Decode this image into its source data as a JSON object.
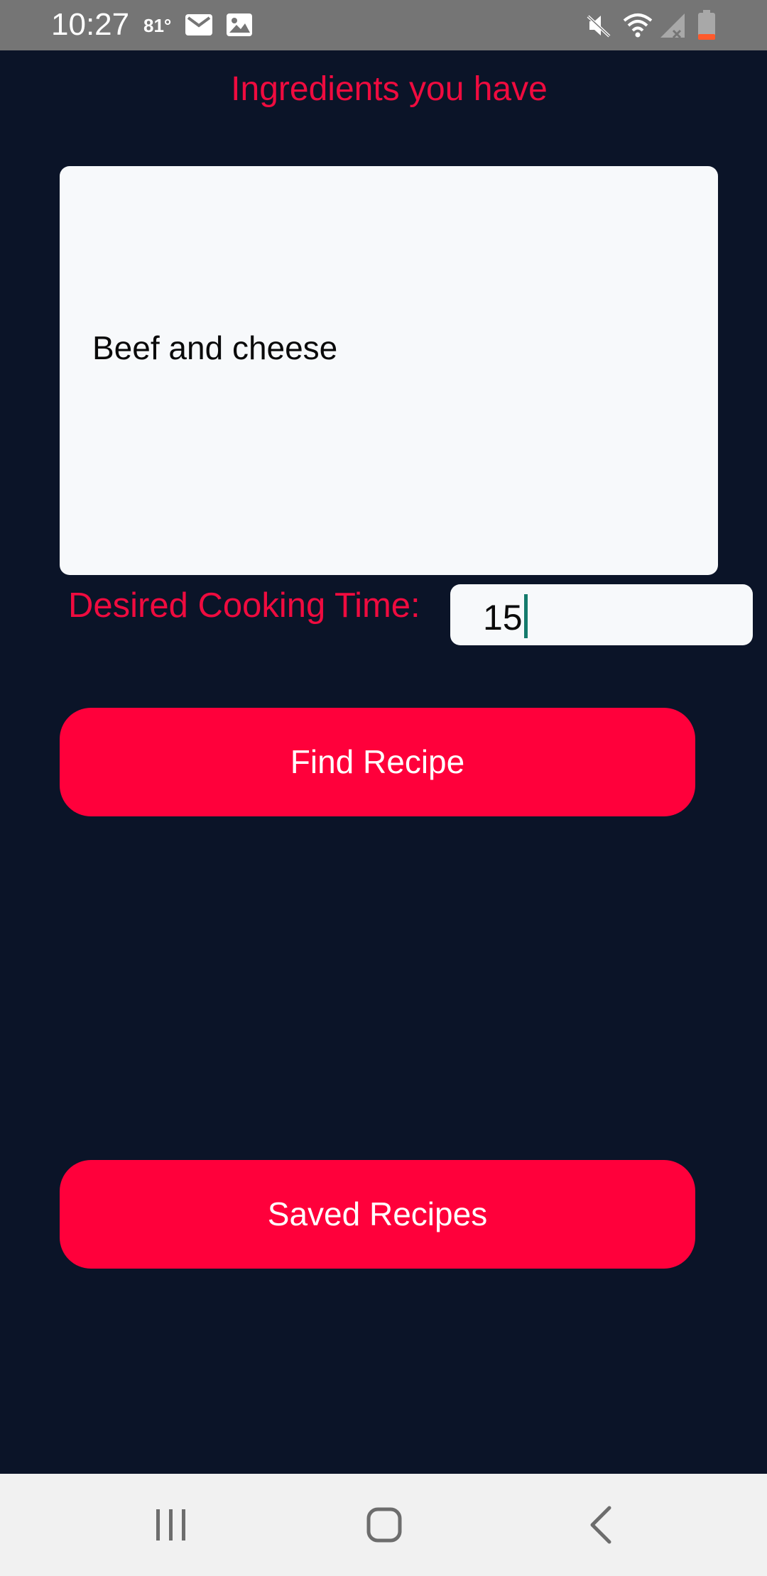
{
  "status_bar": {
    "time": "10:27",
    "temperature": "81°",
    "icons": [
      "mail-icon",
      "image-icon",
      "mute-icon",
      "wifi-icon",
      "signal-icon",
      "battery-icon"
    ]
  },
  "app": {
    "title": "Ingredients you have",
    "ingredients_value": "Beef and cheese",
    "cooking_time_label": "Desired Cooking Time:",
    "cooking_time_value": "15",
    "find_button_label": "Find Recipe",
    "saved_button_label": "Saved Recipes"
  },
  "nav_bar": {
    "buttons": [
      "recent-apps-icon",
      "home-icon",
      "back-icon"
    ]
  },
  "colors": {
    "background": "#0b1428",
    "accent": "#ff003b",
    "label_text": "#ef0b3f",
    "field_background": "#f7f9fb",
    "status_bar": "#757575",
    "nav_bar": "#f1f1f1",
    "cursor": "#147a6c"
  }
}
